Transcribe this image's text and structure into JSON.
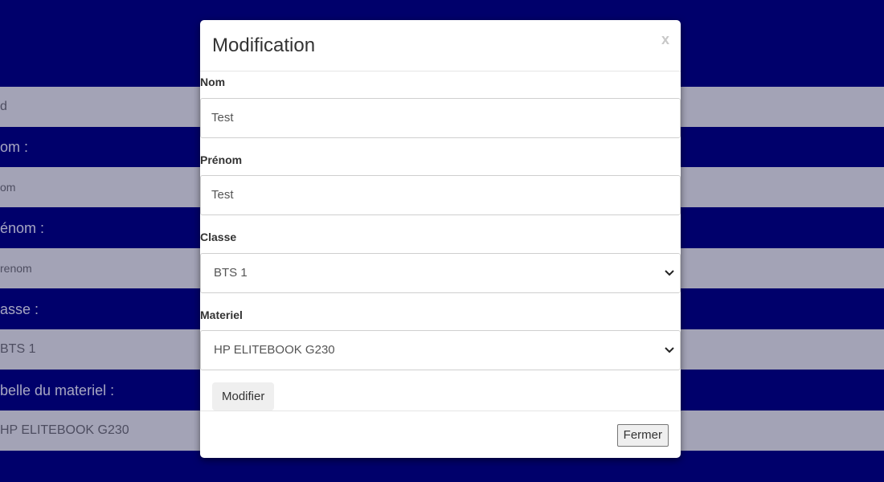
{
  "background": {
    "rows": [
      {
        "kind": "field",
        "text": "d"
      },
      {
        "kind": "label",
        "text": "om :"
      },
      {
        "kind": "field",
        "text": "om"
      },
      {
        "kind": "label",
        "text": "énom :"
      },
      {
        "kind": "field",
        "text": "renom"
      },
      {
        "kind": "label",
        "text": "asse :"
      },
      {
        "kind": "field",
        "text": "BTS 1"
      },
      {
        "kind": "label",
        "text": "belle du materiel :"
      },
      {
        "kind": "field",
        "text": "HP ELITEBOOK G230"
      }
    ]
  },
  "modal": {
    "title": "Modification",
    "close_label": "x",
    "fields": {
      "nom": {
        "label": "Nom",
        "value": "Test"
      },
      "prenom": {
        "label": "Prénom",
        "value": "Test"
      },
      "classe": {
        "label": "Classe",
        "value": "BTS 1"
      },
      "materiel": {
        "label": "Materiel",
        "value": "HP ELITEBOOK G230"
      }
    },
    "submit_label": "Modifier",
    "footer_close_label": "Fermer"
  },
  "colors": {
    "page_background": "#00006b",
    "modal_background": "#ffffff"
  },
  "icons": {
    "select_arrow": "chevron-down-icon"
  }
}
